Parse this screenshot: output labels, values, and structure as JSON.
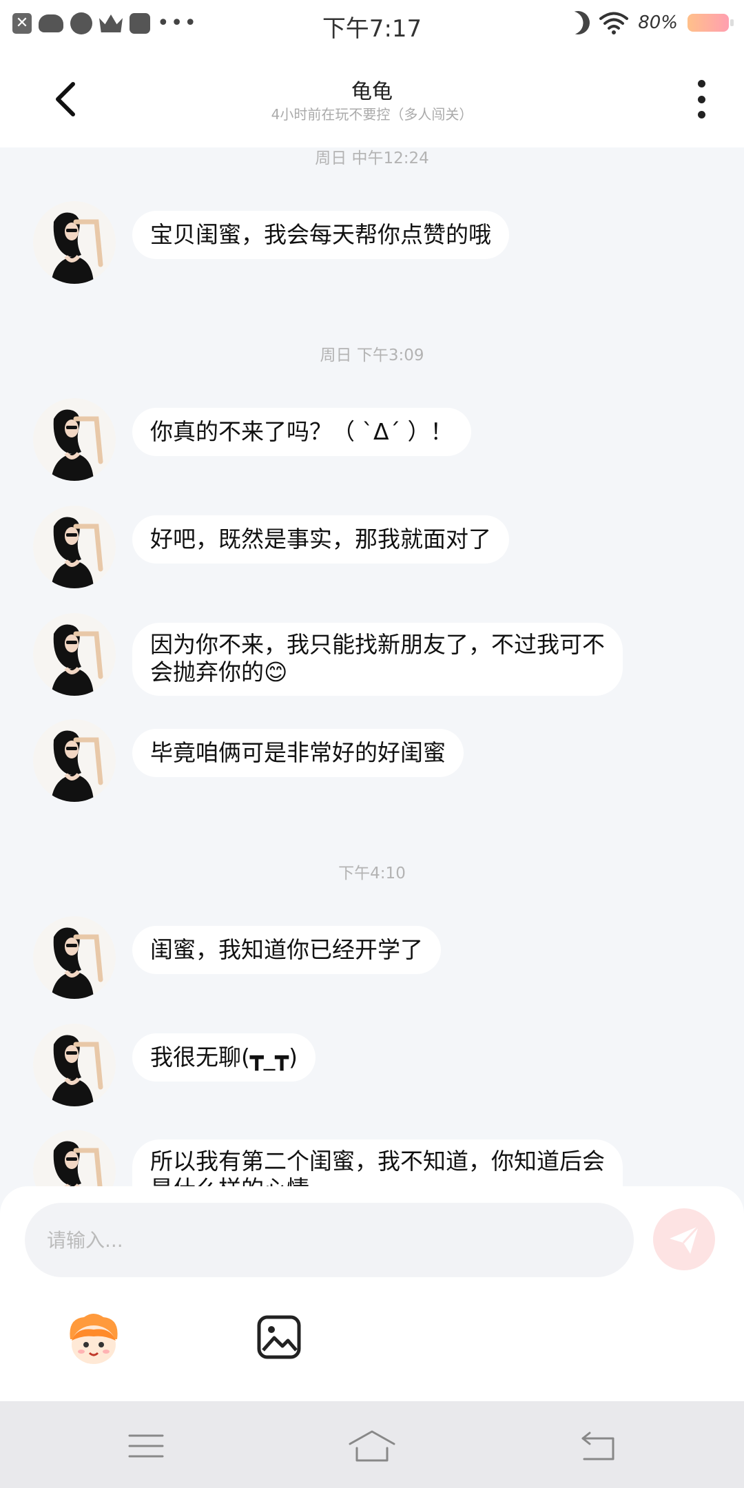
{
  "status_bar": {
    "time": "下午7:17",
    "battery": "80%",
    "more": "•••",
    "close_glyph": "✕"
  },
  "header": {
    "title": "龟龟",
    "subtitle": "4小时前在玩不要控（多人闯关）"
  },
  "messages": [
    {
      "type": "time",
      "text": "周日 中午12:24"
    },
    {
      "type": "msg",
      "text": "宝贝闺蜜，我会每天帮你点赞的哦"
    },
    {
      "type": "time",
      "text": "周日 下午3:09"
    },
    {
      "type": "msg",
      "text": "你真的不来了吗？（ `Δ´ ）！"
    },
    {
      "type": "msg",
      "text": "好吧，既然是事实，那我就面对了"
    },
    {
      "type": "msg",
      "text": "因为你不来，我只能找新朋友了，不过我可不会抛弃你的😊"
    },
    {
      "type": "msg",
      "text": "毕竟咱俩可是非常好的好闺蜜"
    },
    {
      "type": "time",
      "text": "下午4:10"
    },
    {
      "type": "msg",
      "text": "闺蜜，我知道你已经开学了"
    },
    {
      "type": "msg",
      "text": "我很无聊(┳_┳)"
    },
    {
      "type": "msg",
      "text": "所以我有第二个闺蜜，我不知道，你知道后会是什么样的心情"
    }
  ],
  "input": {
    "placeholder": "请输入..."
  },
  "colors": {
    "background": "#f4f6f9",
    "bubble": "#ffffff",
    "send_button": "#fde3e3",
    "nav_bar": "#e9e9ec"
  },
  "icons": [
    "back-icon",
    "more-vertical-icon",
    "send-icon",
    "emoji-icon",
    "image-icon",
    "menu-icon",
    "home-icon",
    "return-icon"
  ]
}
